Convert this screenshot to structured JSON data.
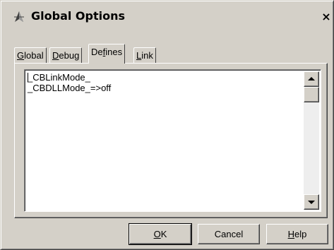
{
  "window": {
    "title": "Global Options",
    "close_label": "×"
  },
  "tabs": [
    {
      "prefix": "",
      "mnemonic": "G",
      "suffix": "lobal",
      "active": false
    },
    {
      "prefix": "",
      "mnemonic": "D",
      "suffix": "ebug",
      "active": false
    },
    {
      "prefix": "De",
      "mnemonic": "f",
      "suffix": "ines",
      "active": true
    },
    {
      "prefix": "",
      "mnemonic": "L",
      "suffix": "ink",
      "active": false
    }
  ],
  "defines": {
    "text": "_CBLinkMode_\n_CBDLLMode_=>off"
  },
  "buttons": {
    "ok": {
      "mnemonic": "O",
      "rest": "K"
    },
    "cancel": {
      "label": "Cancel"
    },
    "help": {
      "mnemonic": "H",
      "rest": "elp"
    }
  },
  "icons": {
    "app": "app-icon",
    "close": "close-icon",
    "scroll_up": "arrow-up-icon",
    "scroll_down": "arrow-down-icon"
  }
}
